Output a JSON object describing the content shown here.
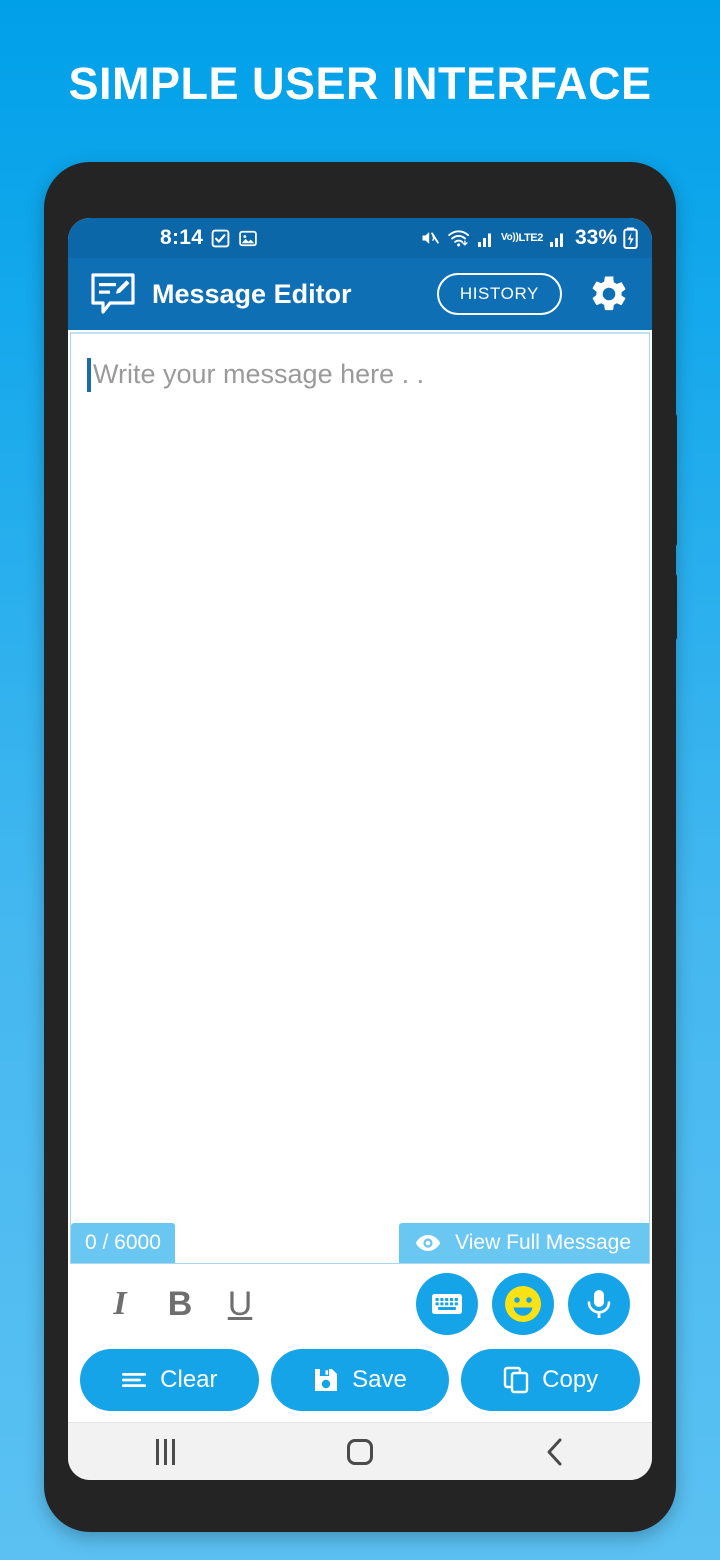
{
  "headline": "SIMPLE USER INTERFACE",
  "statusbar": {
    "time": "8:14",
    "battery_percent": "33%",
    "network_label": "Vo))",
    "network_sub": "LTE2",
    "icons": [
      "checkbox-icon",
      "photo-icon",
      "mute-icon",
      "wifi-icon",
      "signal-icon",
      "volte-icon",
      "signal2-icon",
      "battery-charging-icon"
    ]
  },
  "appbar": {
    "logo": "message-edit-logo",
    "title": "Message Editor",
    "history_label": "HISTORY",
    "settings_icon": "gear-icon"
  },
  "editor": {
    "placeholder": "Write your message here . .",
    "value": "",
    "char_counter": "0 / 6000",
    "view_full_label": "View Full Message",
    "view_full_icon": "eye-icon"
  },
  "format_toolbar": {
    "italic_label": "I",
    "bold_label": "B",
    "underline_label": "U",
    "keyboard_icon": "keyboard-icon",
    "emoji_icon": "emoji-icon",
    "mic_icon": "microphone-icon"
  },
  "actions": [
    {
      "label": "Clear",
      "icon": "clear-lines-icon"
    },
    {
      "label": "Save",
      "icon": "floppy-disk-icon"
    },
    {
      "label": "Copy",
      "icon": "copy-icon"
    }
  ],
  "navbar": {
    "recents": "recents-icon",
    "home": "home-icon",
    "back": "back-icon"
  },
  "colors": {
    "background_top": "#00A0E9",
    "background_bottom": "#5BC1F2",
    "appbar": "#0E6FB4",
    "statusbar": "#0C67A8",
    "accent": "#16A4E8",
    "counter_bar": "#6AC7F2",
    "emoji_yellow": "#FAE215",
    "frame": "#242424"
  }
}
